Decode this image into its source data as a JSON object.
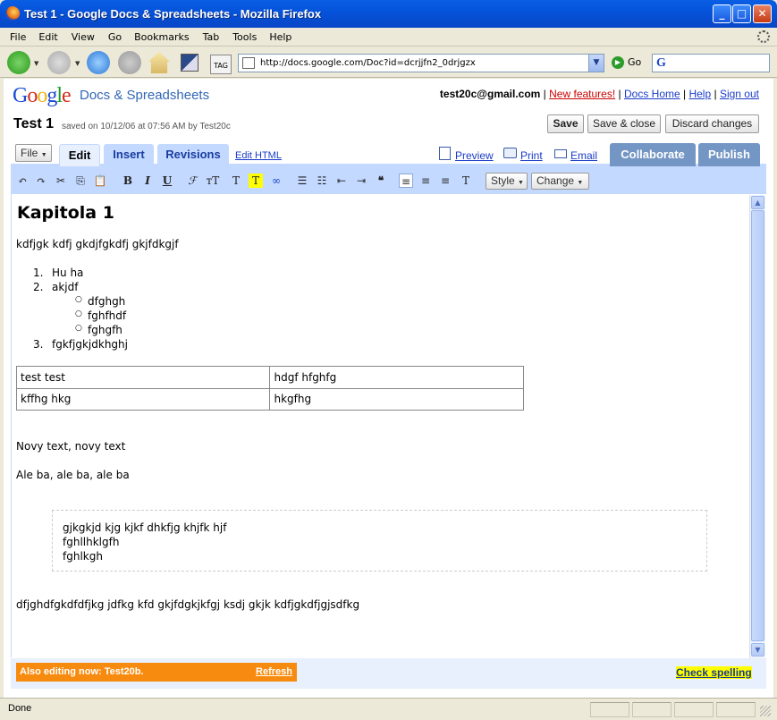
{
  "window": {
    "title": "Test 1 - Google Docs & Spreadsheets - Mozilla Firefox"
  },
  "menu": [
    "File",
    "Edit",
    "View",
    "Go",
    "Bookmarks",
    "Tab",
    "Tools",
    "Help"
  ],
  "nav": {
    "url": "http://docs.google.com/Doc?id=dcrjjfn2_0drjgzx",
    "go_label": "Go",
    "search_logo": "G"
  },
  "header": {
    "logo": "Google",
    "product": "Docs & Spreadsheets",
    "email": "test20c@gmail.com",
    "new_features": "New features!",
    "docs_home": "Docs Home",
    "help": "Help",
    "sign_out": "Sign out"
  },
  "doc": {
    "title": "Test 1",
    "saved": "saved on 10/12/06 at 07:56 AM by Test20c",
    "save": "Save",
    "save_close": "Save & close",
    "discard": "Discard changes"
  },
  "tabs": {
    "file": "File",
    "edit": "Edit",
    "insert": "Insert",
    "revisions": "Revisions",
    "edit_html": "Edit HTML",
    "preview": "Preview",
    "print": "Print",
    "email": "Email",
    "collaborate": "Collaborate",
    "publish": "Publish"
  },
  "toolbar": {
    "style": "Style",
    "change": "Change"
  },
  "content": {
    "heading": "Kapitola 1",
    "para1": "kdfjgk kdfj gkdjfgkdfj gkjfdkgjf",
    "ol": [
      "Hu ha",
      "akjdf",
      "fgkfjgkjdkhghj"
    ],
    "ul": [
      "dfghgh",
      "fghfhdf",
      "fghgfh"
    ],
    "table": [
      [
        "test test",
        "hdgf hfghfg"
      ],
      [
        "kffhg hkg",
        "hkgfhg"
      ]
    ],
    "para2": "Novy text, novy text",
    "para3": "Ale ba, ale ba, ale ba",
    "quote": [
      "gjkgkjd kjg kjkf dhkfjg khjfk hjf",
      "fghllhklgfh",
      "fghlkgh"
    ],
    "para4": "dfjghdfgkdfdfjkg jdfkg kfd gkjfdgkjkfgj ksdj gkjk kdfjgkdfjgjsdfkg"
  },
  "footer": {
    "also_editing": "Also editing now: Test20b.",
    "refresh": "Refresh",
    "check_spelling": "Check spelling"
  },
  "status": {
    "text": "Done"
  }
}
